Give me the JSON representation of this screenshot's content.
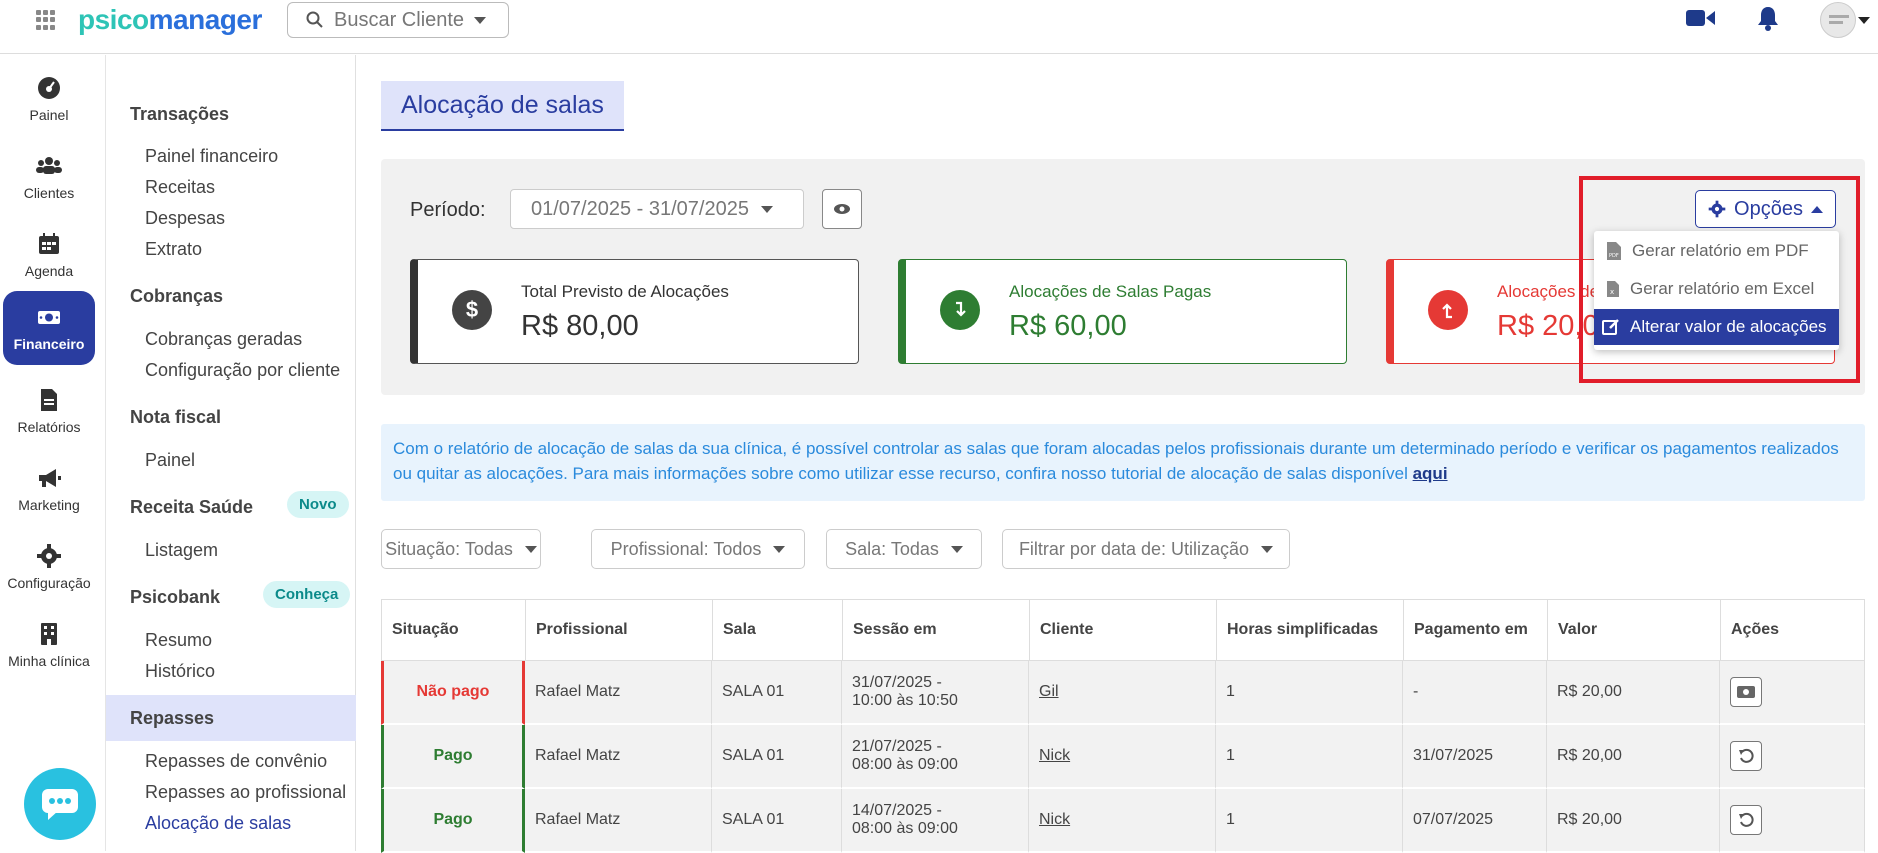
{
  "app": {
    "logo_psi": "psico",
    "logo_rest": "manager"
  },
  "search": {
    "placeholder": "Buscar Cliente"
  },
  "leftnav": [
    {
      "label": "Painel",
      "icon": "gauge-icon"
    },
    {
      "label": "Clientes",
      "icon": "users-icon"
    },
    {
      "label": "Agenda",
      "icon": "calendar-icon"
    },
    {
      "label": "Financeiro",
      "icon": "money-icon",
      "active": true
    },
    {
      "label": "Relatórios",
      "icon": "report-icon"
    },
    {
      "label": "Marketing",
      "icon": "megaphone-icon"
    },
    {
      "label": "Configuração",
      "icon": "gear-icon"
    },
    {
      "label": "Minha clínica",
      "icon": "building-icon"
    }
  ],
  "sidemenu": {
    "transacoes": "Transações",
    "painel_financeiro": "Painel financeiro",
    "receitas": "Receitas",
    "despesas": "Despesas",
    "extrato": "Extrato",
    "cobrancas": "Cobranças",
    "cobrancas_geradas": "Cobranças geradas",
    "config_cliente": "Configuração por cliente",
    "nota_fiscal": "Nota fiscal",
    "nf_painel": "Painel",
    "receita_saude": "Receita Saúde",
    "receita_badge": "Novo",
    "listagem": "Listagem",
    "psicobank": "Psicobank",
    "psicobank_badge": "Conheça",
    "resumo": "Resumo",
    "historico": "Histórico",
    "repasses": "Repasses",
    "repasses_convenio": "Repasses de convênio",
    "repasses_profissional": "Repasses ao profissional",
    "alocacao_salas": "Alocação de salas"
  },
  "main": {
    "title": "Alocação de salas",
    "periodo_label": "Período:",
    "periodo_value": "01/07/2025 - 31/07/2025",
    "cards": [
      {
        "label": "Total Previsto de Alocações",
        "value": "R$ 80,00",
        "icon": "$"
      },
      {
        "label": "Alocações de Salas Pagas",
        "value": "R$ 60,00"
      },
      {
        "label": "Alocações de",
        "value": "R$ 20,0"
      }
    ],
    "opcoes_label": "Opções",
    "dropdown": [
      {
        "label": "Gerar relatório em PDF"
      },
      {
        "label": "Gerar relatório em Excel"
      },
      {
        "label": "Alterar valor de alocações"
      }
    ],
    "info_text": "Com o relatório de alocação de salas da sua clínica, é possível controlar as salas que foram alocadas pelos profissionais durante um determinado período e verificar os pagamentos realizados ou quitar as alocações. Para mais informações sobre como utilizar esse recurso, confira nosso tutorial de alocação de salas disponível",
    "info_link": "aqui",
    "filters": [
      "Situação: Todas",
      "Profissional: Todos",
      "Sala: Todas",
      "Filtrar por data de: Utilização"
    ],
    "table": {
      "headers": [
        "Situação",
        "Profissional",
        "Sala",
        "Sessão em",
        "Cliente",
        "Horas simplificadas",
        "Pagamento em",
        "Valor",
        "Ações"
      ],
      "rows": [
        {
          "situacao": "Não pago",
          "profissional": "Rafael Matz",
          "sala": "SALA 01",
          "sessao1": "31/07/2025 -",
          "sessao2": "10:00 às 10:50",
          "cliente": "Gil",
          "horas": "1",
          "pagamento": "-",
          "valor": "R$ 20,00"
        },
        {
          "situacao": "Pago",
          "profissional": "Rafael Matz",
          "sala": "SALA 01",
          "sessao1": "21/07/2025 -",
          "sessao2": "08:00 às 09:00",
          "cliente": "Nick",
          "horas": "1",
          "pagamento": "31/07/2025",
          "valor": "R$ 20,00"
        },
        {
          "situacao": "Pago",
          "profissional": "Rafael Matz",
          "sala": "SALA 01",
          "sessao1": "14/07/2025 -",
          "sessao2": "08:00 às 09:00",
          "cliente": "Nick",
          "horas": "1",
          "pagamento": "07/07/2025",
          "valor": "R$ 20,00"
        }
      ]
    }
  },
  "colors": {
    "primary": "#2a3da0",
    "success": "#2e7d32",
    "danger": "#e53935",
    "highlight_box": "#e11d2a"
  }
}
